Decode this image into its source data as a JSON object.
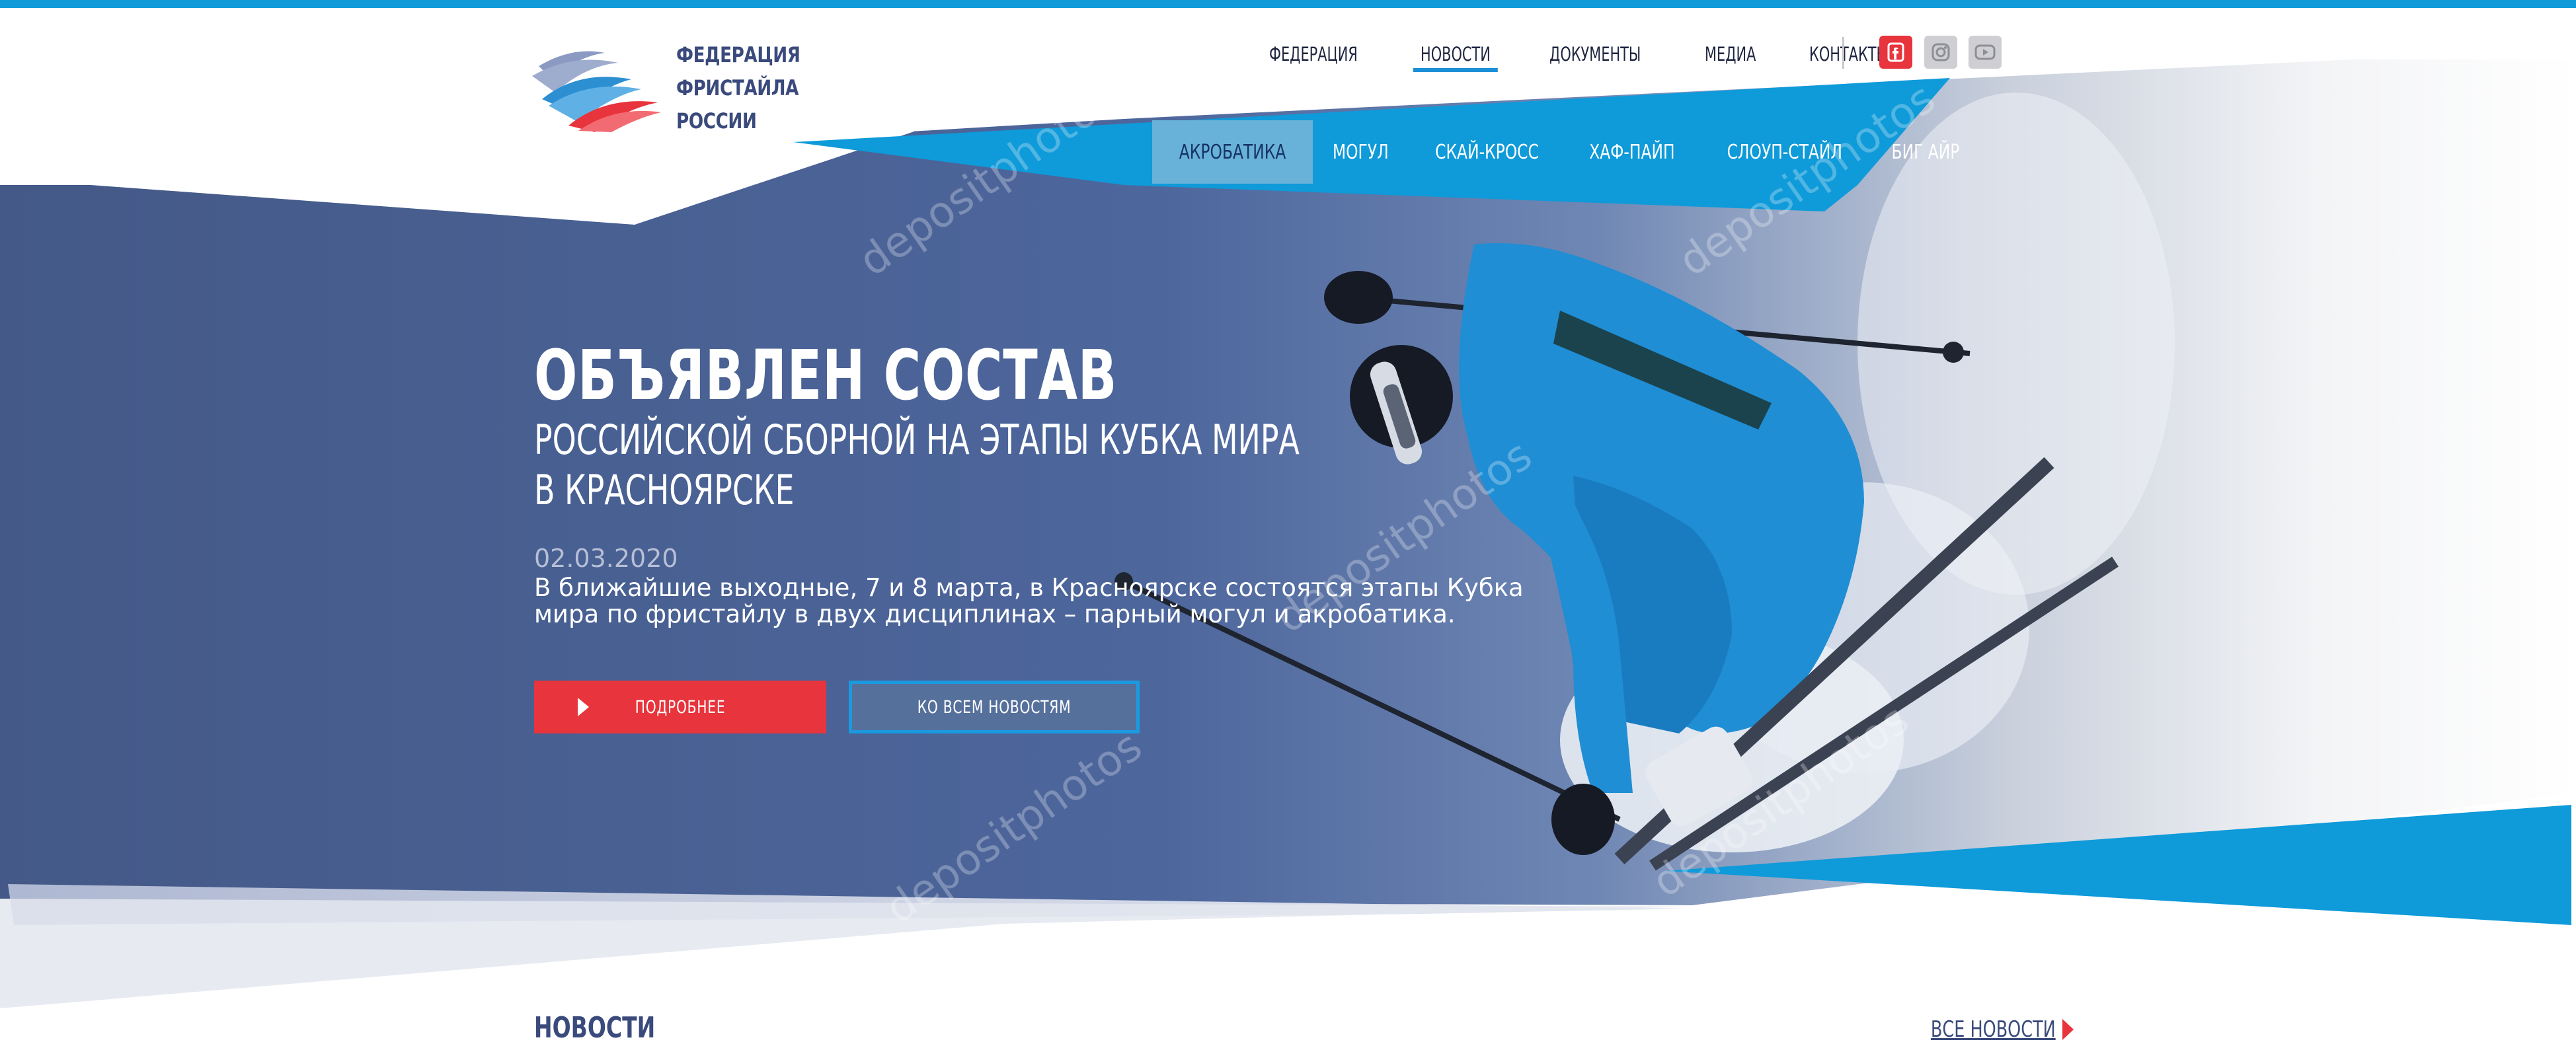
{
  "logo": {
    "lines": [
      "ФЕДЕРАЦИЯ",
      "ФРИСТАЙЛА",
      "РОССИИ"
    ]
  },
  "top_nav": {
    "items": [
      {
        "label": "ФЕДЕРАЦИЯ",
        "active": false
      },
      {
        "label": "НОВОСТИ",
        "active": true
      },
      {
        "label": "ДОКУМЕНТЫ",
        "active": false
      },
      {
        "label": "МЕДИА",
        "active": false
      },
      {
        "label": "КОНТАКТЫ",
        "active": false
      }
    ]
  },
  "social": [
    {
      "icon": "facebook-icon"
    },
    {
      "icon": "instagram-icon"
    },
    {
      "icon": "youtube-icon"
    }
  ],
  "discipline_nav": {
    "items": [
      {
        "label": "АКРОБАТИКА",
        "active": true
      },
      {
        "label": "МОГУЛ",
        "active": false
      },
      {
        "label": "СКАЙ-КРОСС",
        "active": false
      },
      {
        "label": "ХАФ-ПАЙП",
        "active": false
      },
      {
        "label": "СЛОУП-СТАЙЛ",
        "active": false
      },
      {
        "label": "БИГ АЙР",
        "active": false
      }
    ]
  },
  "hero": {
    "title": "ОБЪЯВЛЕН СОСТАВ",
    "subtitle_line1": "РОССИЙСКОЙ СБОРНОЙ НА ЭТАПЫ КУБКА МИРА",
    "subtitle_line2": "В КРАСНОЯРСКЕ",
    "date": "02.03.2020",
    "description": "В ближайшие выходные, 7 и 8 марта, в Красноярске состоятся этапы Кубка мира по фристайлу в двух дисциплинах – парный могул и акробатика.",
    "more_button": "ПОДРОБНЕЕ",
    "all_button": "КО ВСЕМ НОВОСТЯМ",
    "watermark": "depositphotos"
  },
  "news_section": {
    "title": "НОВОСТИ",
    "all_link": "ВСЕ НОВОСТИ"
  },
  "colors": {
    "accent_blue": "#0f9ad9",
    "accent_red": "#e8343c",
    "navy": "#3a4a7c",
    "hero_bg": "#4a5f93"
  }
}
